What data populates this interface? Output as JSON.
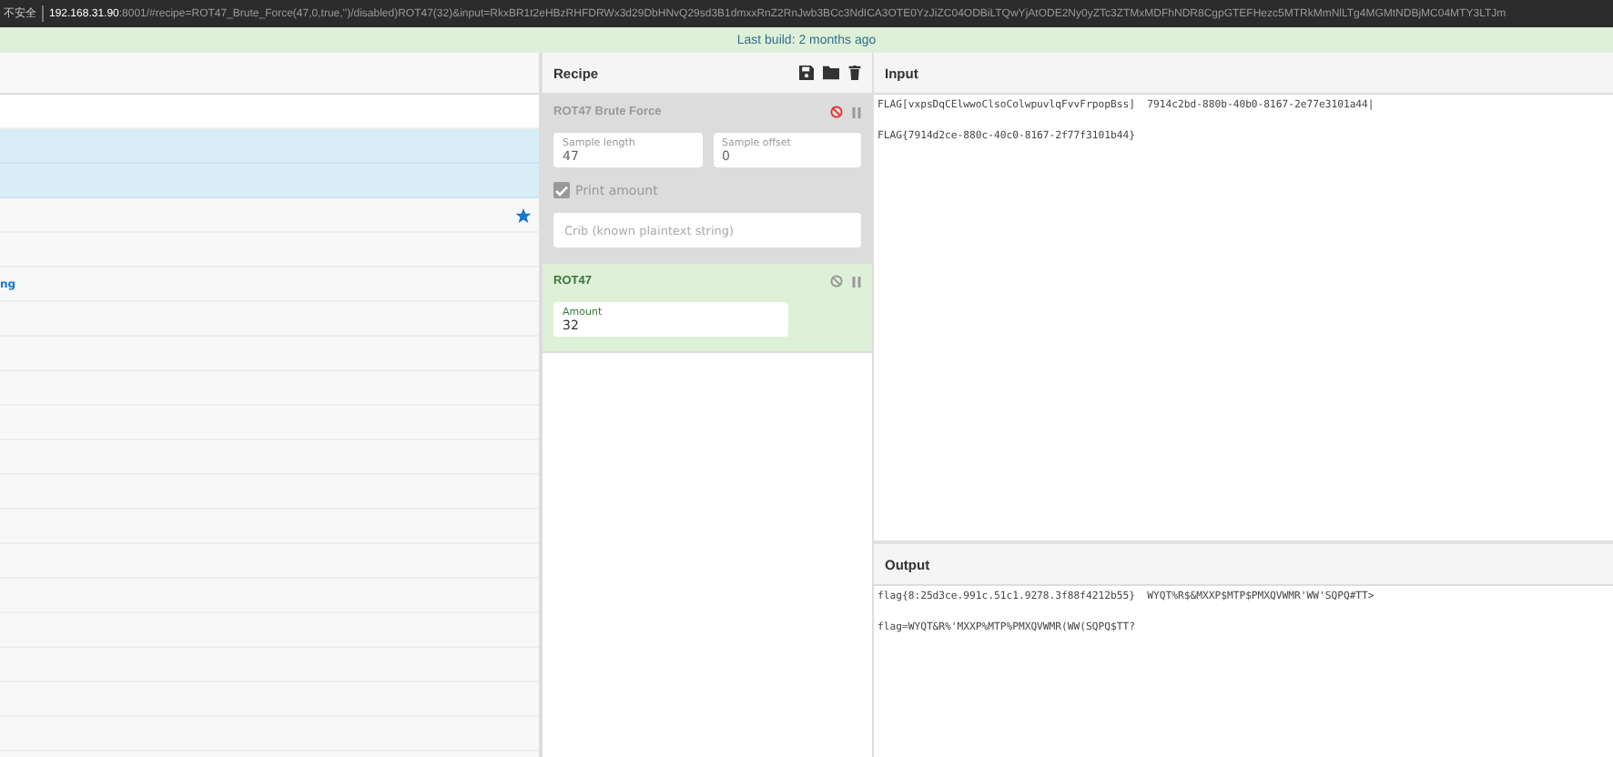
{
  "address_bar": {
    "security": "不安全",
    "host": "192.168.31.90",
    "rest": ":8001/#recipe=ROT47_Brute_Force(47,0,true,'')/disabled)ROT47(32)&input=RkxBR1t2eHBzRHFDRWx3d29DbHNvQ29sd3B1dmxxRnZ2RnJwb3BCc3NdICA3OTE0YzJiZC04ODBiLTQwYjAtODE2Ny0yZTc3ZTMxMDFhNDR8CgpGTEFHezc5MTRkMmNlLTg4MGMtNDBjMC04MTY3LTJm"
  },
  "banner": "Last build: 2 months ago",
  "operations_list": {
    "rows": [
      {
        "selected": false,
        "starred": false
      },
      {
        "selected": true,
        "starred": false
      },
      {
        "selected": true,
        "starred": false
      },
      {
        "selected": false,
        "starred": true
      },
      {
        "selected": false,
        "starred": false
      },
      {
        "selected": false,
        "starred": false,
        "label": "ng"
      },
      {
        "selected": false,
        "starred": false
      },
      {
        "selected": false,
        "starred": false
      },
      {
        "selected": false,
        "starred": false
      },
      {
        "selected": false,
        "starred": false
      },
      {
        "selected": false,
        "starred": false
      },
      {
        "selected": false,
        "starred": false
      },
      {
        "selected": false,
        "starred": false
      },
      {
        "selected": false,
        "starred": false
      },
      {
        "selected": false,
        "starred": false
      },
      {
        "selected": false,
        "starred": false
      },
      {
        "selected": false,
        "starred": false
      },
      {
        "selected": false,
        "starred": false
      },
      {
        "selected": false,
        "starred": false
      }
    ]
  },
  "recipe": {
    "title": "Recipe",
    "operations": [
      {
        "name": "ROT47 Brute Force",
        "disabled": true,
        "args": [
          {
            "kind": "number",
            "label": "Sample length",
            "value": "47"
          },
          {
            "kind": "number",
            "label": "Sample offset",
            "value": "0"
          },
          {
            "kind": "checkbox",
            "label": "Print amount",
            "checked": true
          },
          {
            "kind": "text",
            "placeholder": "Crib (known plaintext string)"
          }
        ]
      },
      {
        "name": "ROT47",
        "disabled": false,
        "args": [
          {
            "kind": "number",
            "label": "Amount",
            "value": "32"
          }
        ]
      }
    ]
  },
  "input": {
    "title": "Input",
    "lines": [
      "FLAG[vxpsDqCElwwoClsoColwpuvlqFvvFrpopBss]  7914c2bd-880b-40b0-8167-2e77e3101a44|",
      "FLAG{7914d2ce-880c-40c0-8167-2f77f3101b44}"
    ]
  },
  "output": {
    "title": "Output",
    "lines": [
      "flag{8:25d3ce.991c.51c1.9278.3f88f4212b55}  WYQT%R$&MXXP$MTP$PMXQVWMR'WW'SQPQ#TT>",
      "flag=WYQT&R%'MXXP%MTP%PMXQVWMR(WW(SQPQ$TT?"
    ]
  }
}
